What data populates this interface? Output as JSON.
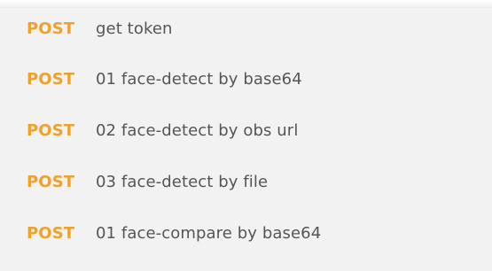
{
  "collection": {
    "requests": [
      {
        "method": "POST",
        "name": "get token"
      },
      {
        "method": "POST",
        "name": "01 face-detect by base64"
      },
      {
        "method": "POST",
        "name": "02 face-detect by obs url"
      },
      {
        "method": "POST",
        "name": "03 face-detect by file"
      },
      {
        "method": "POST",
        "name": "01 face-compare by base64"
      }
    ]
  },
  "colors": {
    "background": "#f2f2f2",
    "method_post": "#f0a12a",
    "request_text": "#555555"
  }
}
